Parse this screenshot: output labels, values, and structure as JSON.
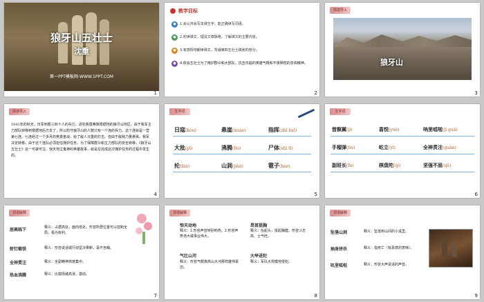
{
  "slides": [
    {
      "number": "1",
      "title": "狼牙山五壮士",
      "author": "沈重",
      "footer": "第一PPT模板网-WWW.1PPT.COM"
    },
    {
      "number": "2",
      "heading": "教学目标",
      "goals": [
        "1.会认并会写本课生字，能正确读写词语。",
        "2.初读课文，理清文章脉络，了解课文的主要内容。",
        "3.有感情地朗读课文，背诵第四五壮士跳崖的部分。",
        "4.体会五壮士为了掩护群众和大部队，抗击日寇的英雄气概和不畏牺牲的崇高精神。"
      ]
    },
    {
      "number": "3",
      "tag": "情境导入",
      "caption": "狼牙山"
    },
    {
      "number": "4",
      "tag": "情境导入",
      "text": "1941年的秋天，日军到晋三四十人的兵力，进犯我晋察冀根据地的狼牙山地区。由于我军主力部队转移到根据地后方去了，所以防守狼牙山的人数只有一个连的兵力。这个连就是一营第七连。七连经过一个多月的英勇奋战，给了敌人沉重的打击。但由于敌我力量悬殊，我军决定转移。由于这个连队必须担任掩护任务，为了保障群众和主力部队的安全转移，《狼牙山五壮士》这一可歌可泣、惊天地泣鬼神的英雄故事，就是在完成这次掩护任务的过程中发生的。"
    },
    {
      "number": "5",
      "tag": "生字词",
      "words": [
        {
          "w": "日寇",
          "p": "(kòu)"
        },
        {
          "w": "悬崖",
          "p": "(xuán)"
        },
        {
          "w": "指挥",
          "p": "(zhǐ huī)"
        },
        {
          "w": "大批",
          "p": "(pī)"
        },
        {
          "w": "沸腾",
          "p": "(fèi)"
        },
        {
          "w": "尸体",
          "p": "(shī tǐ)"
        },
        {
          "w": "抡",
          "p": "(lūn)"
        },
        {
          "w": "山涧",
          "p": "(jiàn)"
        },
        {
          "w": "雹子",
          "p": "(báo)"
        }
      ]
    },
    {
      "number": "6",
      "tag": "生字词",
      "words": [
        {
          "w": "晋察冀",
          "p": "(jì)"
        },
        {
          "w": "喜悦",
          "p": "(yuè)"
        },
        {
          "w": "呐里呱啦",
          "p": "(jī guā)"
        },
        {
          "w": "手榴弹",
          "p": "(liú)"
        },
        {
          "w": "屹立",
          "p": "(yì)"
        },
        {
          "w": "全神贯注",
          "p": "(guàn)"
        },
        {
          "w": "副班长",
          "p": "(fù)"
        },
        {
          "w": "棋盘陀",
          "p": "(qí)"
        },
        {
          "w": "坚强不屈",
          "p": "(qū)"
        }
      ]
    },
    {
      "number": "7",
      "tag": "词语解释",
      "items": [
        {
          "k": "居高临下",
          "d": "释义：占据高处，面向低处。形容所居位置可以控制全局，极为有利。"
        },
        {
          "k": "斩钉截铁",
          "d": "释义：形容说话或行动坚决果断，毫不含糊。"
        },
        {
          "k": "全神贯注",
          "d": "释义：全副精神高度集中。"
        },
        {
          "k": "热血沸腾",
          "d": "释义：比喻情绪高涨、激动。"
        }
      ]
    },
    {
      "number": "8",
      "tag": "词语解释",
      "items": [
        {
          "k": "惊天动地",
          "d": "释义：1.形容声音特别响亮。2.形容声势浩大或事业伟大。"
        },
        {
          "k": "昂首挺胸",
          "d": "释义：抬起头，挺起胸膛。形容斗志高、士气旺。"
        },
        {
          "k": "气壮山河",
          "d": "释义：形容气概像高山大河那样雄伟豪迈。"
        },
        {
          "k": "大举进犯",
          "d": "释义：军队大规模地侵犯。"
        }
      ]
    },
    {
      "number": "9",
      "tag": "词语解释",
      "items": [
        {
          "k": "坠落山涧",
          "d": "释义：坠落到山间的小溪里。"
        },
        {
          "k": "抽身拼杀",
          "d": "释义：指死亡（有恶意的意味）。"
        },
        {
          "k": "叽里呱啦",
          "d": "释义：形容大声说话的声音。"
        }
      ]
    }
  ],
  "colors": {
    "accent": "#c0392b",
    "tag": "#d98f8f",
    "blue": "#3a7bbf"
  }
}
